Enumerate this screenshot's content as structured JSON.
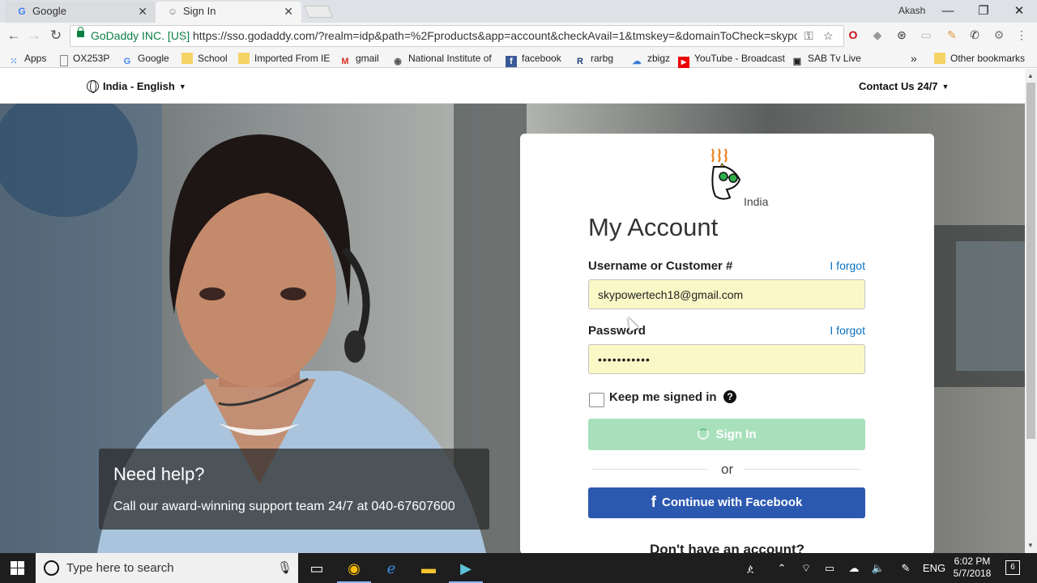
{
  "browser": {
    "tabs": [
      {
        "label": "Google",
        "favicon": "google-icon",
        "active": false
      },
      {
        "label": "Sign In",
        "favicon": "godaddy-icon",
        "active": true
      }
    ],
    "window_user": "Akash",
    "site_identity": "GoDaddy INC. [US]",
    "url": "https://sso.godaddy.com/?realm=idp&path=%2Fproducts&app=account&checkAvail=1&tmskey=&domainToCheck=skypowe...",
    "bookmarks": [
      {
        "label": "Apps",
        "icon": "apps-grid-icon"
      },
      {
        "label": "OX253P",
        "icon": "page-icon"
      },
      {
        "label": "Google",
        "icon": "google-icon"
      },
      {
        "label": "School",
        "icon": "folder-icon"
      },
      {
        "label": "Imported From IE",
        "icon": "folder-icon"
      },
      {
        "label": "gmail",
        "icon": "gmail-icon"
      },
      {
        "label": "National Institute of",
        "icon": "nit-icon"
      },
      {
        "label": "facebook",
        "icon": "facebook-icon"
      },
      {
        "label": "rarbg",
        "icon": "rarbg-icon"
      },
      {
        "label": "zbigz",
        "icon": "zbigz-icon"
      },
      {
        "label": "YouTube - Broadcast",
        "icon": "youtube-icon"
      },
      {
        "label": "SAB Tv Live",
        "icon": "tv-icon"
      }
    ],
    "bookmarks_overflow": "»",
    "other_bookmarks": "Other bookmarks"
  },
  "site_header": {
    "language": "India - English",
    "contact": "Contact Us 24/7"
  },
  "login": {
    "logo_region": "India",
    "title": "My Account",
    "username_label": "Username or Customer #",
    "username_forgot": "I forgot",
    "username_value": "skypowertech18@gmail.com",
    "password_label": "Password",
    "password_forgot": "I forgot",
    "password_value": "•••••••••••",
    "keep_signed_in": "Keep me signed in",
    "help_glyph": "?",
    "sign_in": "Sign In",
    "or": "or",
    "facebook": "Continue with Facebook",
    "no_account": "Don't have an account?"
  },
  "help_panel": {
    "title": "Need help?",
    "text": "Call our award-winning support team 24/7 at 040-67607600"
  },
  "taskbar": {
    "search_placeholder": "Type here to search",
    "language": "ENG",
    "time": "6:02 PM",
    "date": "5/7/2018",
    "notifications": "6"
  },
  "colors": {
    "signin_button": "#a9e0bc",
    "facebook_button": "#2c59b0",
    "autofill_field": "#fbf8c7",
    "link": "#0b71c1"
  }
}
